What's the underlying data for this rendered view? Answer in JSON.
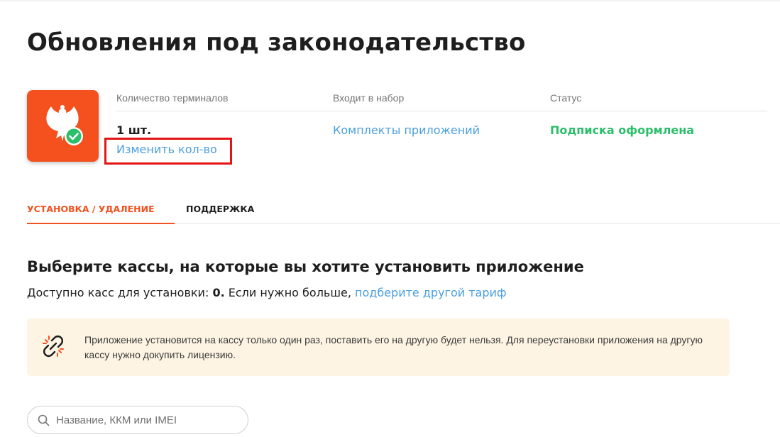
{
  "page": {
    "title": "Обновления под законодательство"
  },
  "app": {
    "logo_icon": "eagle-check-icon",
    "brand_color": "#f4511e"
  },
  "info": {
    "quantity_header": "Количество терминалов",
    "quantity_value": "1 шт.",
    "change_quantity_link": "Изменить кол-во",
    "bundle_header": "Входит в набор",
    "bundle_link": "Комплекты приложений",
    "status_header": "Статус",
    "status_value": "Подписка оформлена",
    "status_color": "#2bbf6a",
    "link_color": "#4a9fe0"
  },
  "tabs": [
    {
      "label": "УСТАНОВКА / УДАЛЕНИЕ",
      "active": true
    },
    {
      "label": "ПОДДЕРЖКА",
      "active": false
    }
  ],
  "install": {
    "heading": "Выберите кассы, на которые вы хотите установить приложение",
    "available_prefix": "Доступно касс для установки: ",
    "available_count": "0.",
    "available_suffix": " Если нужно больше, ",
    "tariff_link": "подберите другой тариф",
    "notice_icon": "broken-link-icon",
    "notice_text": "Приложение установится на кассу только один раз, поставить его на другую будет нельзя. Для переустановки приложения на другую кассу нужно докупить лицензию.",
    "notice_bg": "#fdf4e3"
  },
  "search": {
    "placeholder": "Название, ККМ или IMEI",
    "value": "",
    "icon": "search-icon"
  },
  "annotation": {
    "highlight_color": "#e31414"
  }
}
